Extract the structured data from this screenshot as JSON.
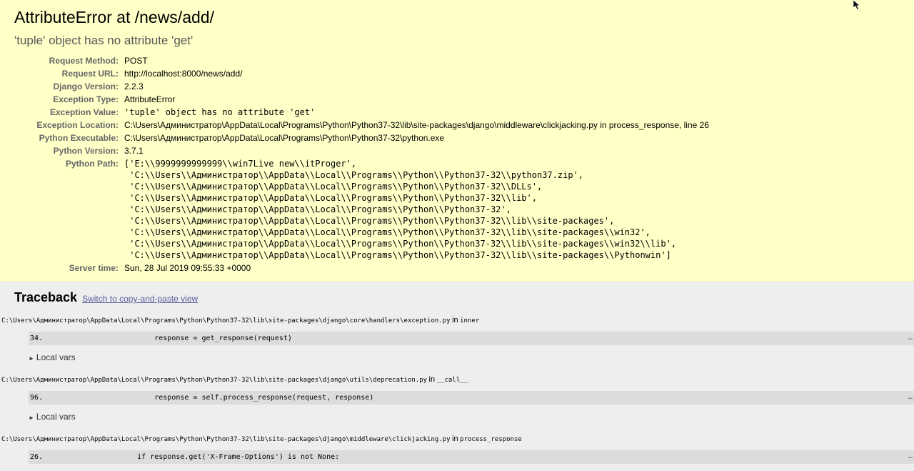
{
  "summary": {
    "title": "AttributeError at /news/add/",
    "subtitle": "'tuple' object has no attribute 'get'",
    "meta": [
      {
        "label": "Request Method:",
        "value": "POST",
        "mono": false
      },
      {
        "label": "Request URL:",
        "value": "http://localhost:8000/news/add/",
        "mono": false
      },
      {
        "label": "Django Version:",
        "value": "2.2.3",
        "mono": false
      },
      {
        "label": "Exception Type:",
        "value": "AttributeError",
        "mono": false
      },
      {
        "label": "Exception Value:",
        "value": "'tuple' object has no attribute 'get'",
        "mono": true
      },
      {
        "label": "Exception Location:",
        "value": "C:\\Users\\Администратор\\AppData\\Local\\Programs\\Python\\Python37-32\\lib\\site-packages\\django\\middleware\\clickjacking.py in process_response, line 26",
        "mono": false
      },
      {
        "label": "Python Executable:",
        "value": "C:\\Users\\Администратор\\AppData\\Local\\Programs\\Python\\Python37-32\\python.exe",
        "mono": false
      },
      {
        "label": "Python Version:",
        "value": "3.7.1",
        "mono": false
      }
    ],
    "python_path_label": "Python Path:",
    "python_path": "['E:\\\\9999999999999\\\\win7Live new\\\\itProger',\n 'C:\\\\Users\\\\Администратор\\\\AppData\\\\Local\\\\Programs\\\\Python\\\\Python37-32\\\\python37.zip',\n 'C:\\\\Users\\\\Администратор\\\\AppData\\\\Local\\\\Programs\\\\Python\\\\Python37-32\\\\DLLs',\n 'C:\\\\Users\\\\Администратор\\\\AppData\\\\Local\\\\Programs\\\\Python\\\\Python37-32\\\\lib',\n 'C:\\\\Users\\\\Администратор\\\\AppData\\\\Local\\\\Programs\\\\Python\\\\Python37-32',\n 'C:\\\\Users\\\\Администратор\\\\AppData\\\\Local\\\\Programs\\\\Python\\\\Python37-32\\\\lib\\\\site-packages',\n 'C:\\\\Users\\\\Администратор\\\\AppData\\\\Local\\\\Programs\\\\Python\\\\Python37-32\\\\lib\\\\site-packages\\\\win32',\n 'C:\\\\Users\\\\Администратор\\\\AppData\\\\Local\\\\Programs\\\\Python\\\\Python37-32\\\\lib\\\\site-packages\\\\win32\\\\lib',\n 'C:\\\\Users\\\\Администратор\\\\AppData\\\\Local\\\\Programs\\\\Python\\\\Python37-32\\\\lib\\\\site-packages\\\\Pythonwin']",
    "server_time_label": "Server time:",
    "server_time": "Sun, 28 Jul 2019 09:55:33 +0000"
  },
  "traceback": {
    "heading": "Traceback",
    "switch_link": "Switch to copy-and-paste view",
    "in_word": "in",
    "frames": [
      {
        "file": "C:\\Users\\Администратор\\AppData\\Local\\Programs\\Python\\Python37-32\\lib\\site-packages\\django\\core\\handlers\\exception.py",
        "func": "inner",
        "lineno": "34.",
        "code": "            response = get_response(request)",
        "ellipsis": "…",
        "local_vars": "Local vars"
      },
      {
        "file": "C:\\Users\\Администратор\\AppData\\Local\\Programs\\Python\\Python37-32\\lib\\site-packages\\django\\utils\\deprecation.py",
        "func": "__call__",
        "lineno": "96.",
        "code": "            response = self.process_response(request, response)",
        "ellipsis": "…",
        "local_vars": "Local vars"
      },
      {
        "file": "C:\\Users\\Администратор\\AppData\\Local\\Programs\\Python\\Python37-32\\lib\\site-packages\\django\\middleware\\clickjacking.py",
        "func": "process_response",
        "lineno": "26.",
        "code": "        if response.get('X-Frame-Options') is not None:",
        "ellipsis": "…",
        "local_vars": ""
      }
    ]
  },
  "colors": {
    "summary_bg": "#ffffc8",
    "traceback_bg": "#eeeeee",
    "code_bg": "#dcdcdc",
    "link": "#5b5b9b"
  },
  "icons": {
    "cursor": "mouse-pointer-icon",
    "toggle": "triangle-right-icon"
  }
}
